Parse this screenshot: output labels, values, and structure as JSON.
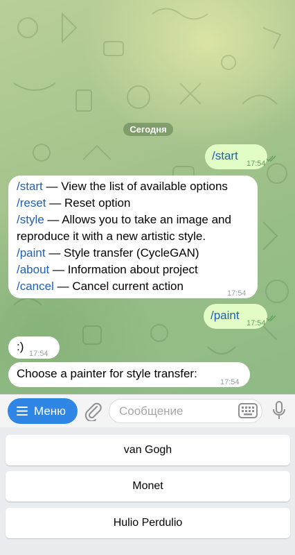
{
  "chat": {
    "date_label": "Сегодня",
    "messages": [
      {
        "direction": "out",
        "text": "/start",
        "time": "17:54",
        "status": "read"
      },
      {
        "direction": "in",
        "lines": [
          {
            "cmd": "/start",
            "desc": " — View the list of available options"
          },
          {
            "cmd": "/reset",
            "desc": " — Reset option"
          },
          {
            "cmd": "/style",
            "desc": " — Allows you to take an image and reproduce it with a new artistic style."
          },
          {
            "cmd": "/paint",
            "desc": " — Style transfer (CycleGAN)"
          },
          {
            "cmd": "/about",
            "desc": " — Information about project"
          },
          {
            "cmd": "/cancel",
            "desc": " — Cancel current action"
          }
        ],
        "time": "17:54"
      },
      {
        "direction": "out",
        "text": "/paint",
        "time": "17:54",
        "status": "read"
      },
      {
        "direction": "in",
        "text": ":)",
        "time": "17:54"
      },
      {
        "direction": "in",
        "text": "Choose a painter for style transfer:",
        "time": "17:54"
      }
    ]
  },
  "input_bar": {
    "menu_label": "Меню",
    "menu_icon": "hamburger-icon",
    "attach_icon": "paperclip-icon",
    "placeholder": "Сообщение",
    "value": "",
    "keyboard_icon": "keyboard-icon",
    "mic_icon": "microphone-icon"
  },
  "reply_keyboard": {
    "buttons": [
      "van Gogh",
      "Monet",
      "Hulio Perdulio"
    ]
  },
  "colors": {
    "accent": "#2f86e5",
    "command_link": "#1e5fb8",
    "outgoing_bubble": "#e2fcc6",
    "incoming_bubble": "#ffffff",
    "read_check": "#5ea25a"
  }
}
